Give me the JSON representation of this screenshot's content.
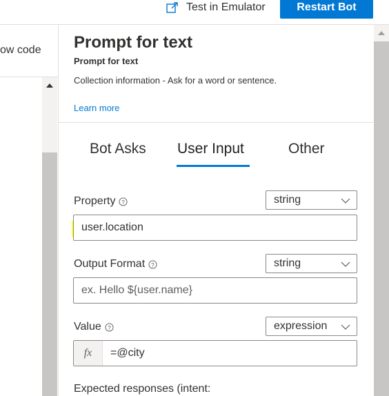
{
  "toolbar": {
    "test_emulator_label": "Test in Emulator",
    "restart_bot_label": "Restart Bot"
  },
  "left_pane": {
    "show_code_label": "ow code"
  },
  "panel": {
    "title": "Prompt for text",
    "subtitle": "Prompt for text",
    "description": "Collection information - Ask for a word or sentence.",
    "learn_more": "Learn more",
    "tabs": [
      {
        "label": "Bot Asks",
        "active": false
      },
      {
        "label": "User Input",
        "active": true
      },
      {
        "label": "Other",
        "active": false
      }
    ],
    "fields": {
      "property": {
        "label": "Property",
        "type": "string",
        "value": "user.location"
      },
      "output_format": {
        "label": "Output Format",
        "type": "string",
        "placeholder": "ex. Hello ${user.name}"
      },
      "value": {
        "label": "Value",
        "type": "expression",
        "fx": "fx",
        "value": "=@city"
      }
    },
    "expected_responses_label": "Expected responses (intent:"
  },
  "colors": {
    "accent": "#0078d4",
    "highlight": "#ffff00"
  },
  "icons": [
    "open-external-icon",
    "info-icon",
    "chevron-down-icon",
    "scroll-up-arrow-icon"
  ]
}
